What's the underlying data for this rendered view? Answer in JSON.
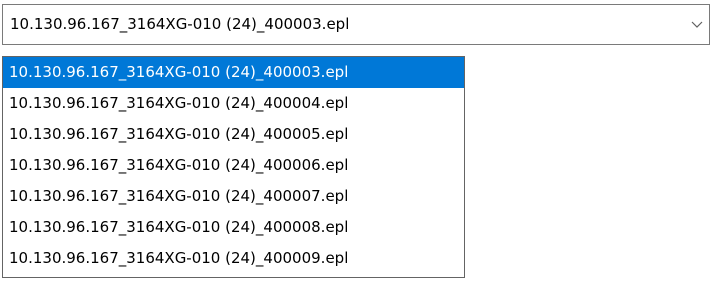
{
  "combo": {
    "value": "10.130.96.167_3164XG-010 (24)_400003.epl",
    "arrow_icon": "chevron-down-icon"
  },
  "dropdown": {
    "selected_index": 0,
    "options": [
      "10.130.96.167_3164XG-010 (24)_400003.epl",
      "10.130.96.167_3164XG-010 (24)_400004.epl",
      "10.130.96.167_3164XG-010 (24)_400005.epl",
      "10.130.96.167_3164XG-010 (24)_400006.epl",
      "10.130.96.167_3164XG-010 (24)_400007.epl",
      "10.130.96.167_3164XG-010 (24)_400008.epl",
      "10.130.96.167_3164XG-010 (24)_400009.epl"
    ]
  },
  "colors": {
    "highlight": "#0078d7",
    "border": "#7a7a7a"
  }
}
